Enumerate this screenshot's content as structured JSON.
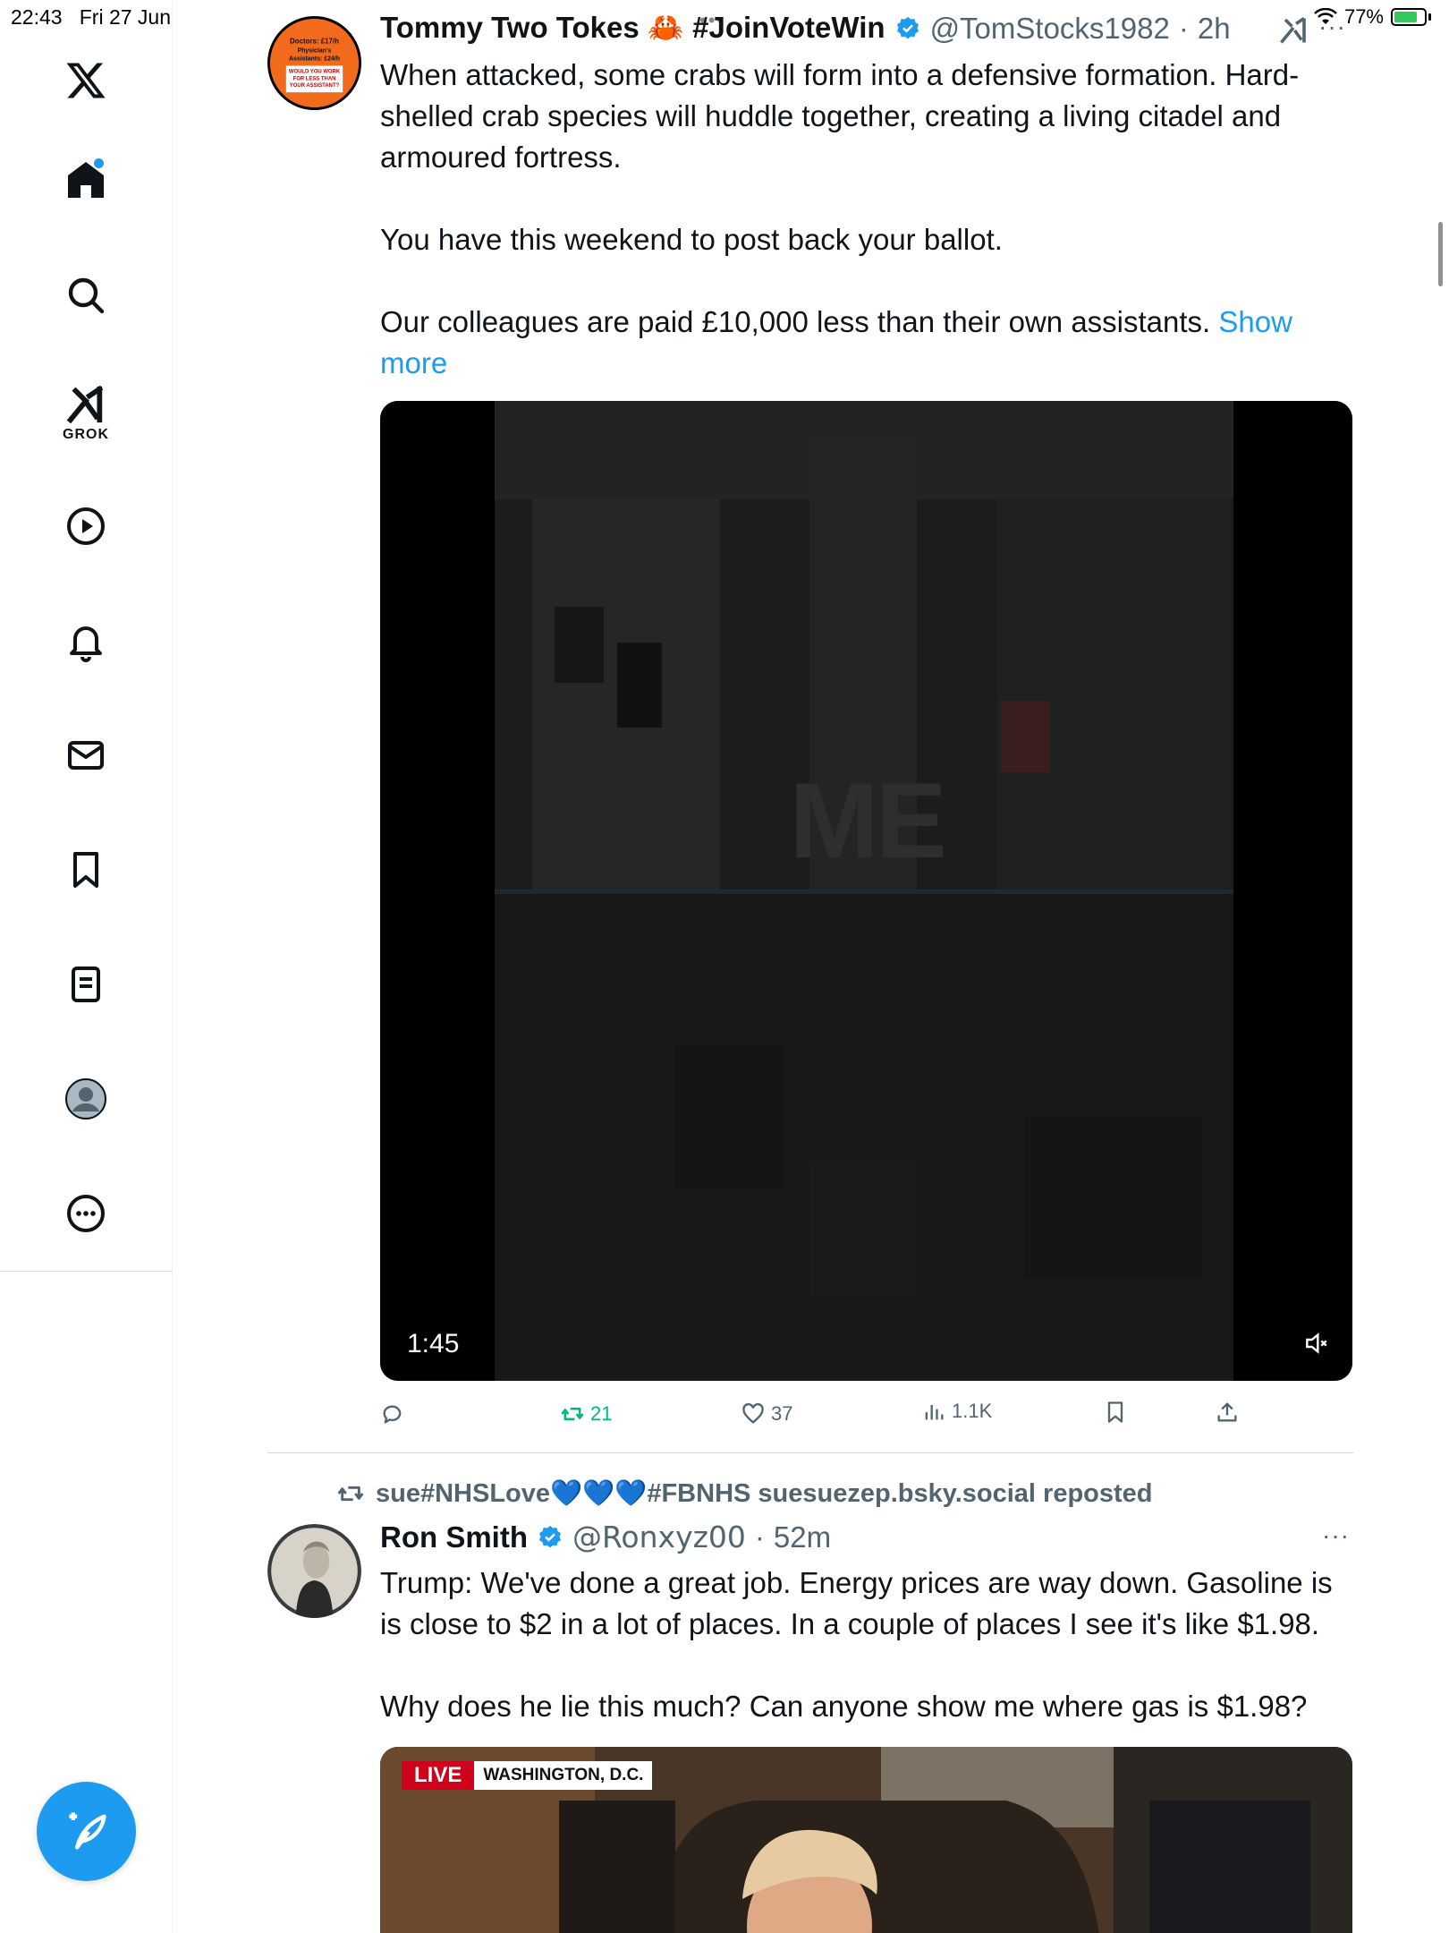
{
  "status_bar": {
    "time": "22:43",
    "date": "Fri 27 Jun",
    "battery_percent": "77%",
    "battery_level": 0.77,
    "battery_charging": true
  },
  "sidebar": {
    "items": [
      {
        "name": "x-logo",
        "icon": "x-logo-icon"
      },
      {
        "name": "home",
        "icon": "home-icon",
        "has_notification_dot": true
      },
      {
        "name": "search",
        "icon": "search-icon"
      },
      {
        "name": "grok",
        "icon": "grok-icon",
        "label": "GROK"
      },
      {
        "name": "video",
        "icon": "play-icon"
      },
      {
        "name": "notifications",
        "icon": "bell-icon"
      },
      {
        "name": "messages",
        "icon": "envelope-icon"
      },
      {
        "name": "bookmarks",
        "icon": "bookmark-icon"
      },
      {
        "name": "lists",
        "icon": "list-icon"
      },
      {
        "name": "profile",
        "icon": "avatar-icon"
      },
      {
        "name": "more",
        "icon": "more-circle-icon"
      }
    ],
    "compose_icon": "compose-feather-icon"
  },
  "colors": {
    "accent": "#1d9bf0",
    "text": "#0f1419",
    "secondary_text": "#536471",
    "repost_green": "#00ba7c"
  },
  "tweet1": {
    "display_name": "Tommy Two Tokes 🦀 #JoinVoteWin",
    "handle": "@TomStocks1982",
    "separator": "·",
    "time": "2h",
    "avatar_text": "Doctors: £17/h Physician's Assistants: £24/h WOULD YOU WORK FOR LESS THAN YOUR ASSISTANT?",
    "text_p1": "When attacked, some crabs will form into a defensive formation. Hard-shelled crab species will huddle together, creating a living citadel and armoured fortress.",
    "text_p2": "You have this weekend to post back your ballot.",
    "text_p3": "Our colleagues are paid £10,000 less than their own assistants.",
    "show_more": "Show more",
    "video": {
      "duration": "1:45",
      "overlay_text": "ME",
      "muted": true
    },
    "actions": {
      "reply": "",
      "reposts": "21",
      "likes": "37",
      "views": "1.1K"
    }
  },
  "tweet2": {
    "repost_by": "sue#NHSLove💙💙💙#FBNHS suesuezep.bsky.social reposted",
    "display_name": "Ron Smith",
    "handle": "@Ronxyz00",
    "separator": "·",
    "time": "52m",
    "text_p1": "Trump: We've done a great job. Energy prices are way down. Gasoline is is close to $2 in a lot of places. In a couple of places I see it's like $1.98.",
    "text_p2": "Why does he lie this much? Can anyone show me where gas is $1.98?",
    "media": {
      "live_badge": "LIVE",
      "location": "WASHINGTON, D.C."
    }
  }
}
